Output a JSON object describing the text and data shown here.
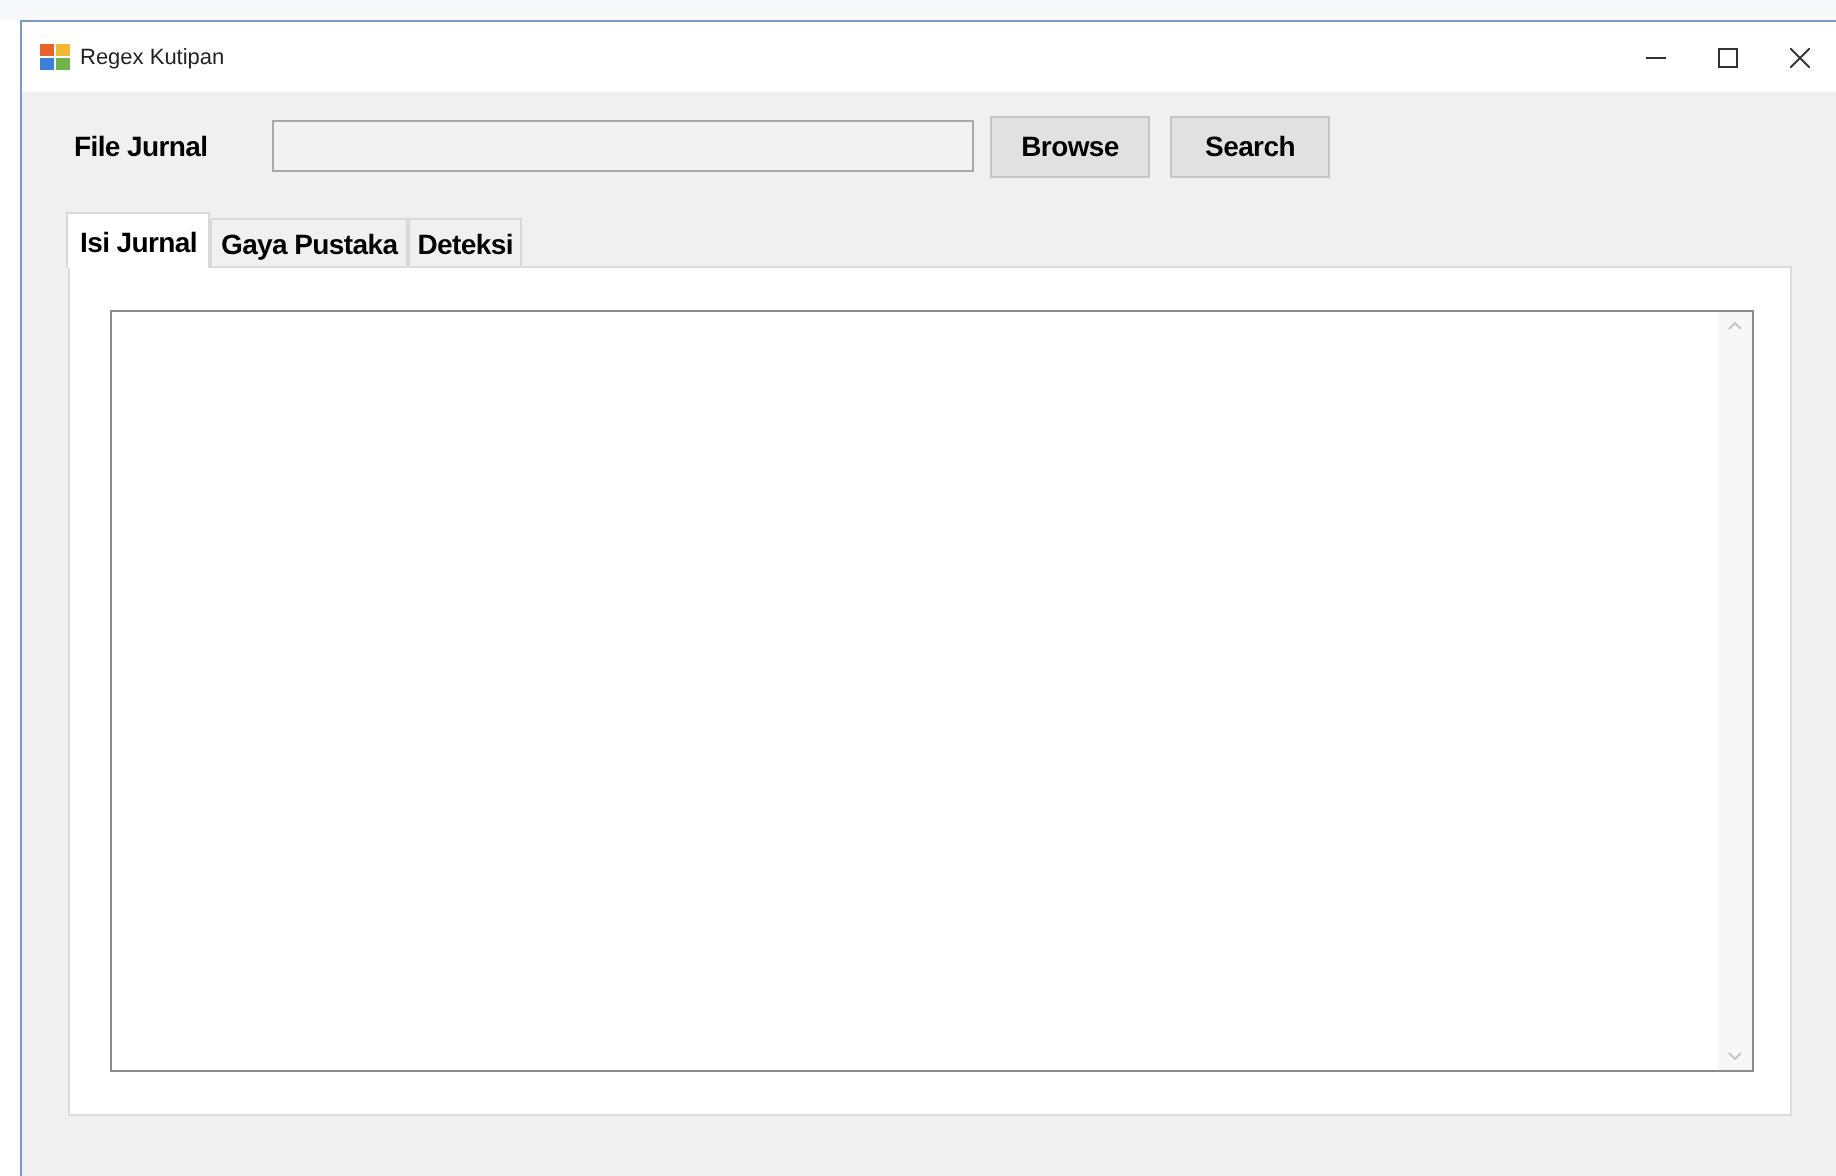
{
  "window": {
    "title": "Regex Kutipan"
  },
  "file_row": {
    "label": "File Jurnal",
    "buttons": [
      "Browse",
      "Search"
    ]
  },
  "tabs": [
    {
      "label": "Isi Jurnal",
      "selected": true
    },
    {
      "label": "Gaya Pustaka",
      "selected": false
    },
    {
      "label": "Deteksi",
      "selected": false
    }
  ]
}
